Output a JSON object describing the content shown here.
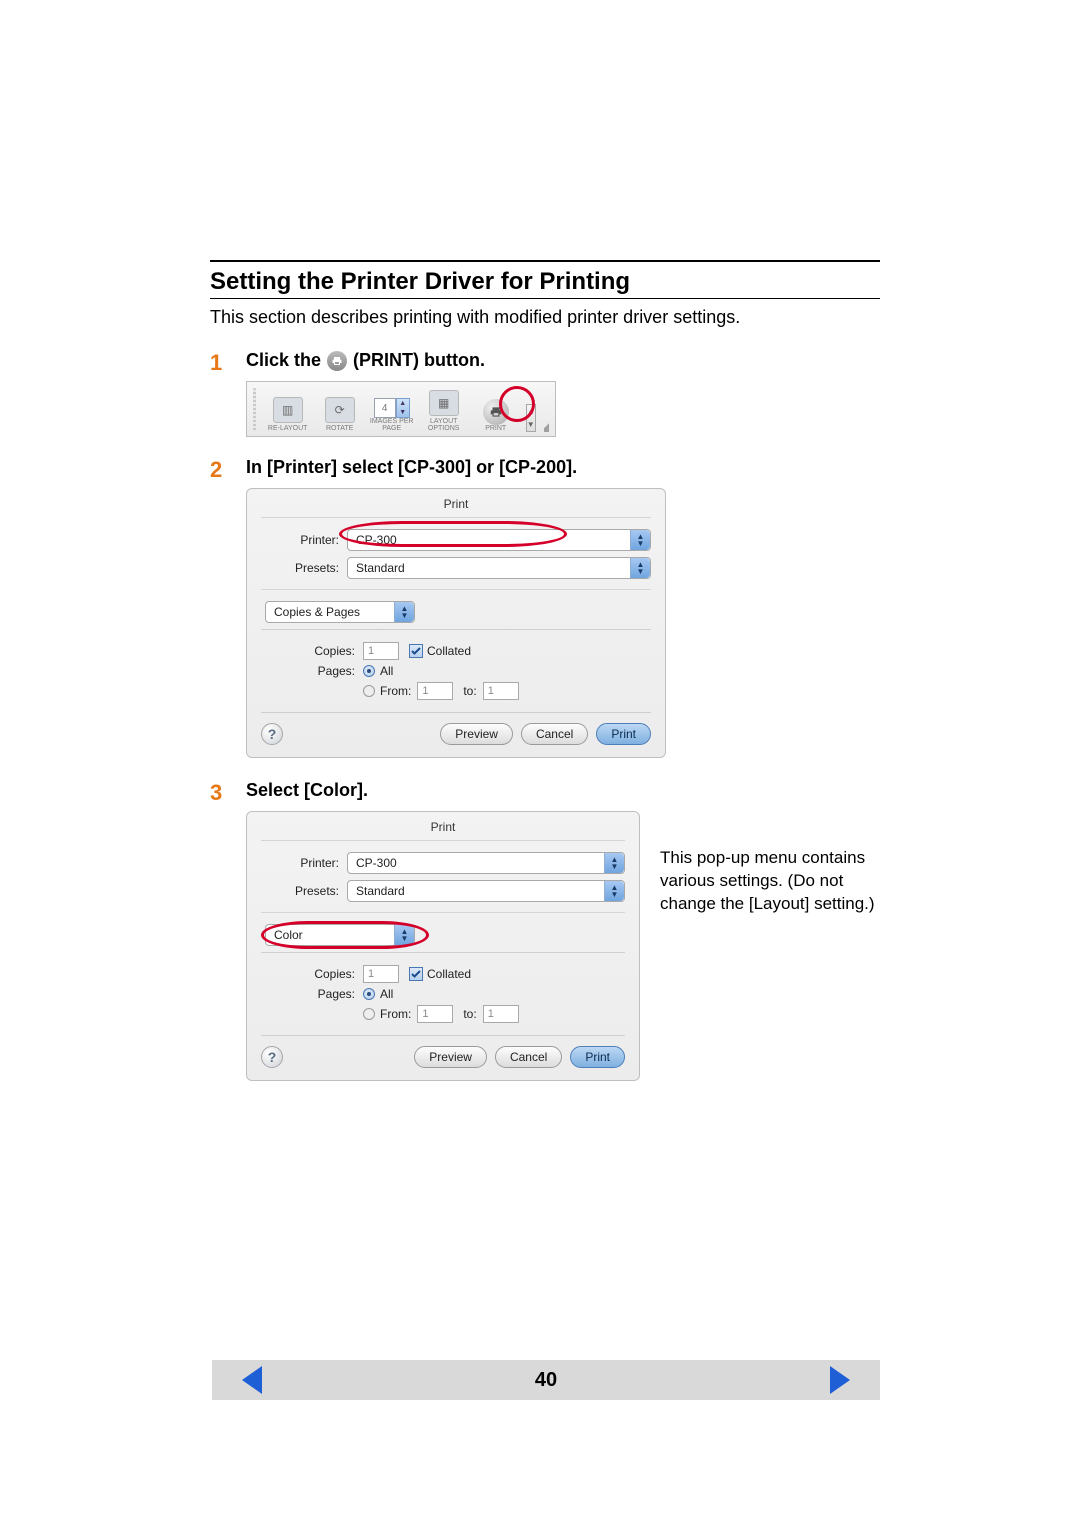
{
  "heading": "Setting the Printer Driver for Printing",
  "intro": "This section describes printing with modified printer driver settings.",
  "steps": {
    "s1": {
      "num": "1",
      "prefix": "Click the ",
      "suffix": " (PRINT) button."
    },
    "s2": {
      "num": "2",
      "title": "In [Printer] select [CP-300] or [CP-200]."
    },
    "s3": {
      "num": "3",
      "title": "Select [Color]."
    }
  },
  "toolbar": {
    "relayout": "RE-LAYOUT",
    "rotate": "ROTATE",
    "images_num": "4",
    "images_lbl": "IMAGES PER PAGE",
    "layout": "LAYOUT OPTIONS",
    "print": "PRINT"
  },
  "dialog": {
    "title": "Print",
    "printer_lbl": "Printer:",
    "printer_val": "CP-300",
    "presets_lbl": "Presets:",
    "presets_val": "Standard",
    "section1": "Copies & Pages",
    "section2": "Color",
    "copies_lbl": "Copies:",
    "copies_val": "1",
    "collated": "Collated",
    "pages_lbl": "Pages:",
    "all": "All",
    "from": "From:",
    "from_val": "1",
    "to": "to:",
    "to_val": "1",
    "preview": "Preview",
    "cancel": "Cancel",
    "print": "Print",
    "help": "?"
  },
  "side_note": "This pop-up menu contains various settings. (Do not change the [Layout] setting.)",
  "page_number": "40"
}
